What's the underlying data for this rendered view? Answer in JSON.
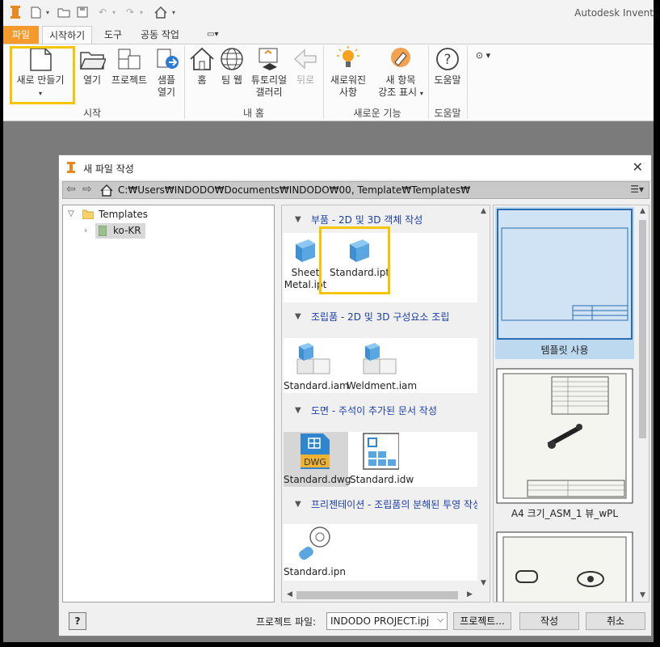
{
  "window": {
    "app_title": "Autodesk Invent"
  },
  "ribbon": {
    "tabs": [
      {
        "label": "파일"
      },
      {
        "label": "시작하기"
      },
      {
        "label": "도구"
      },
      {
        "label": "공동 작업"
      }
    ],
    "buttons": {
      "new": "새로 만들기",
      "open": "열기",
      "projects": "프로젝트",
      "sample1": "샘플",
      "sample2": "열기",
      "home": "홈",
      "team": "팀 웹",
      "tutorial1": "튜토리얼",
      "tutorial2": "갤러리",
      "back": "뒤로",
      "whatsnew1": "새로워진",
      "whatsnew2": "사항",
      "highlight1": "새 항목",
      "highlight2": "강조 표시",
      "help": "도움말"
    },
    "groups": {
      "start": "시작",
      "myhome": "내 홈",
      "newfeatures": "새로운 기능",
      "help": "도움말"
    }
  },
  "dialog": {
    "title": "새 파일 작성",
    "path": "C:₩Users₩INDODO₩Documents₩INDODO₩00, Template₩Templates₩",
    "tree": {
      "root": "Templates",
      "child": "ko-KR"
    },
    "sections": [
      {
        "label": "부품 - 2D 및 3D 객체 작성",
        "items": [
          {
            "label1": "Sheet",
            "label2": "Metal.ipt"
          },
          {
            "label1": "Standard.ipt",
            "label2": ""
          }
        ]
      },
      {
        "label": "조립품 - 2D 및 3D 구성요소 조립",
        "items": [
          {
            "label1": "Standard.iam"
          },
          {
            "label1": "Weldment.iam"
          }
        ]
      },
      {
        "label": "도면 - 주석이 추가된 문서 작성",
        "items": [
          {
            "label1": "Standard.dwg"
          },
          {
            "label1": "Standard.idw"
          }
        ]
      },
      {
        "label": "프리젠테이션 - 조립품의 분해된 투영 작성",
        "items": [
          {
            "label1": "Standard.ipn"
          }
        ]
      }
    ],
    "dwg_badge": "DWG",
    "previews": [
      {
        "caption": "템플릿 사용"
      },
      {
        "caption": "A4 크기_ASM_1 뷰_wPL"
      }
    ],
    "footer": {
      "project_label": "프로젝트 파일:",
      "project_value": "INDODO PROJECT.ipj",
      "projects_button": "프로젝트...",
      "create_button": "작성",
      "cancel_button": "취소"
    }
  },
  "colors": {
    "file_tab": "#f49a2c",
    "highlight": "#f6c400",
    "section_text": "#1c3ea8",
    "part_blue": "#5aa6e0"
  }
}
